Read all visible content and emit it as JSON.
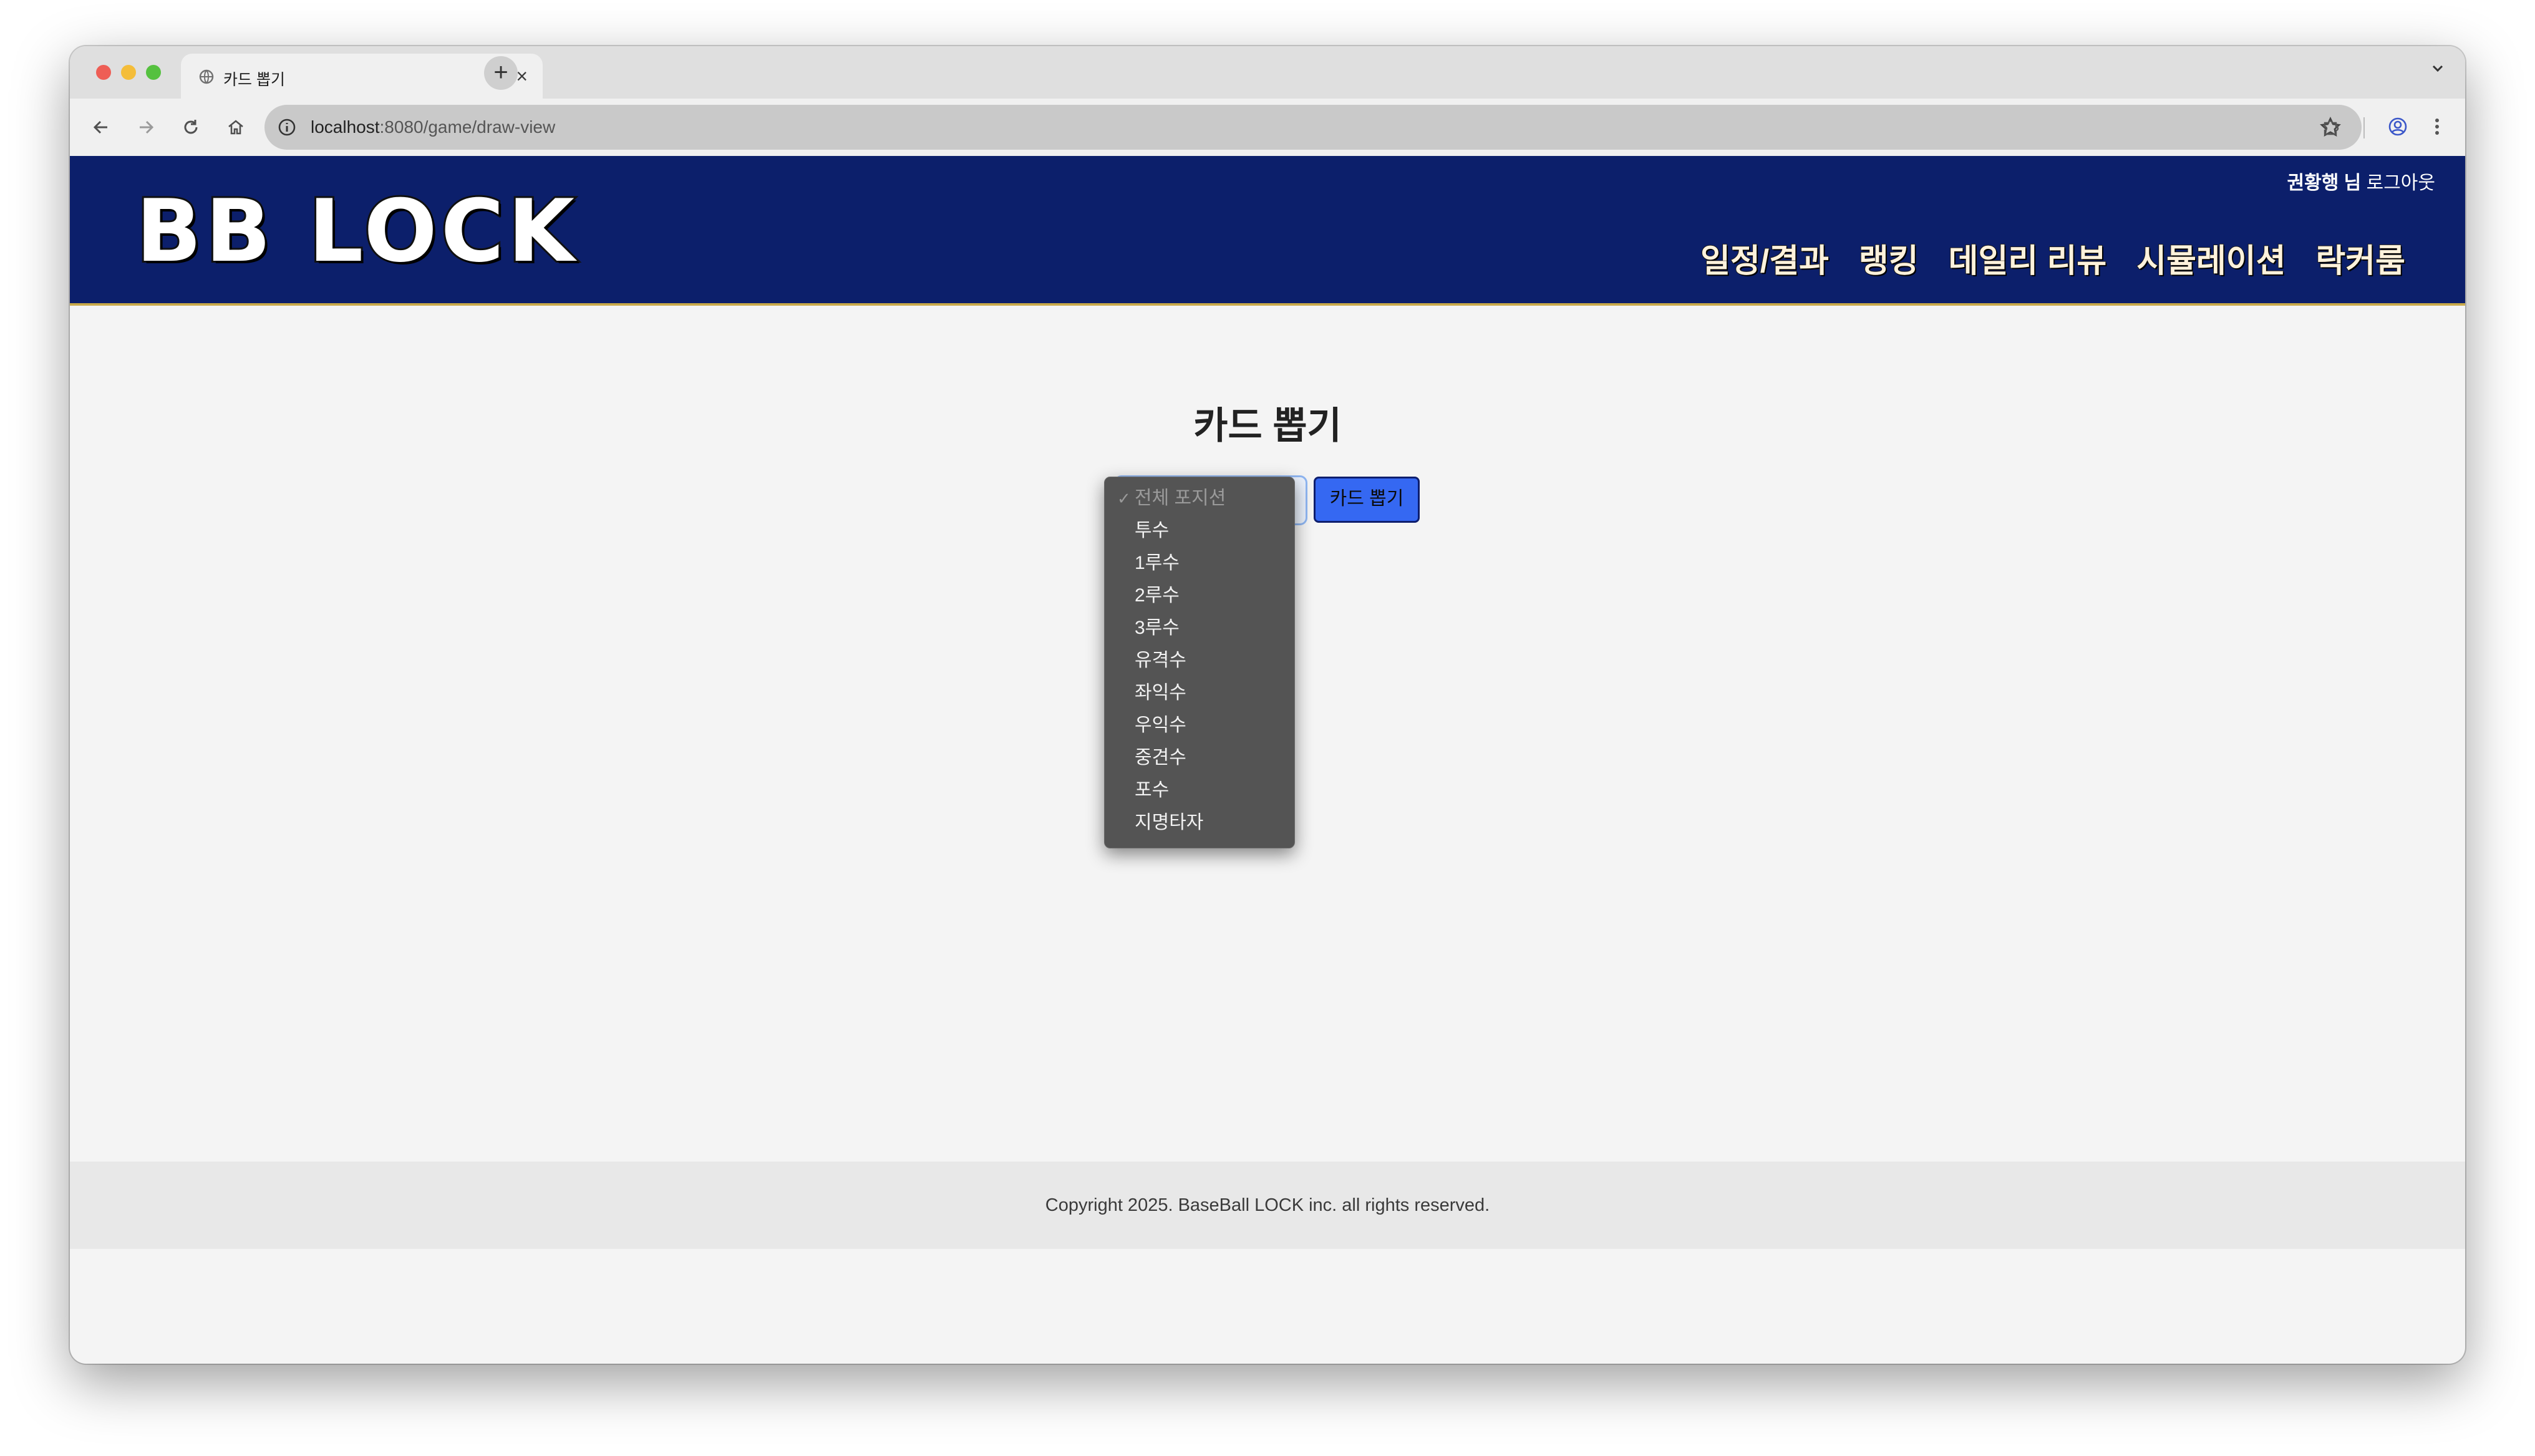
{
  "browser": {
    "tab_title": "카드 뽑기",
    "tab_close": "×",
    "new_tab": "+",
    "url_host": "localhost",
    "url_rest": ":8080/game/draw-view"
  },
  "site": {
    "logo": "BB LOCK",
    "user_name": "권황행 님",
    "logout": "로그아웃",
    "nav": [
      "일정/결과",
      "랭킹",
      "데일리 리뷰",
      "시뮬레이션",
      "락커룸"
    ]
  },
  "main": {
    "title": "카드 뽑기",
    "position_select": {
      "selected": "전체 포지션",
      "options": [
        "전체 포지션",
        "투수",
        "1루수",
        "2루수",
        "3루수",
        "유격수",
        "좌익수",
        "우익수",
        "중견수",
        "포수",
        "지명타자"
      ]
    },
    "draw_button": "카드 뽑기"
  },
  "footer": {
    "copyright": "Copyright 2025. BaseBall LOCK inc. all rights reserved."
  },
  "colors": {
    "header_bg": "#0c1f6b",
    "header_border": "#c9a94a",
    "button_bg": "#3568f2",
    "dropdown_bg": "#545454"
  }
}
